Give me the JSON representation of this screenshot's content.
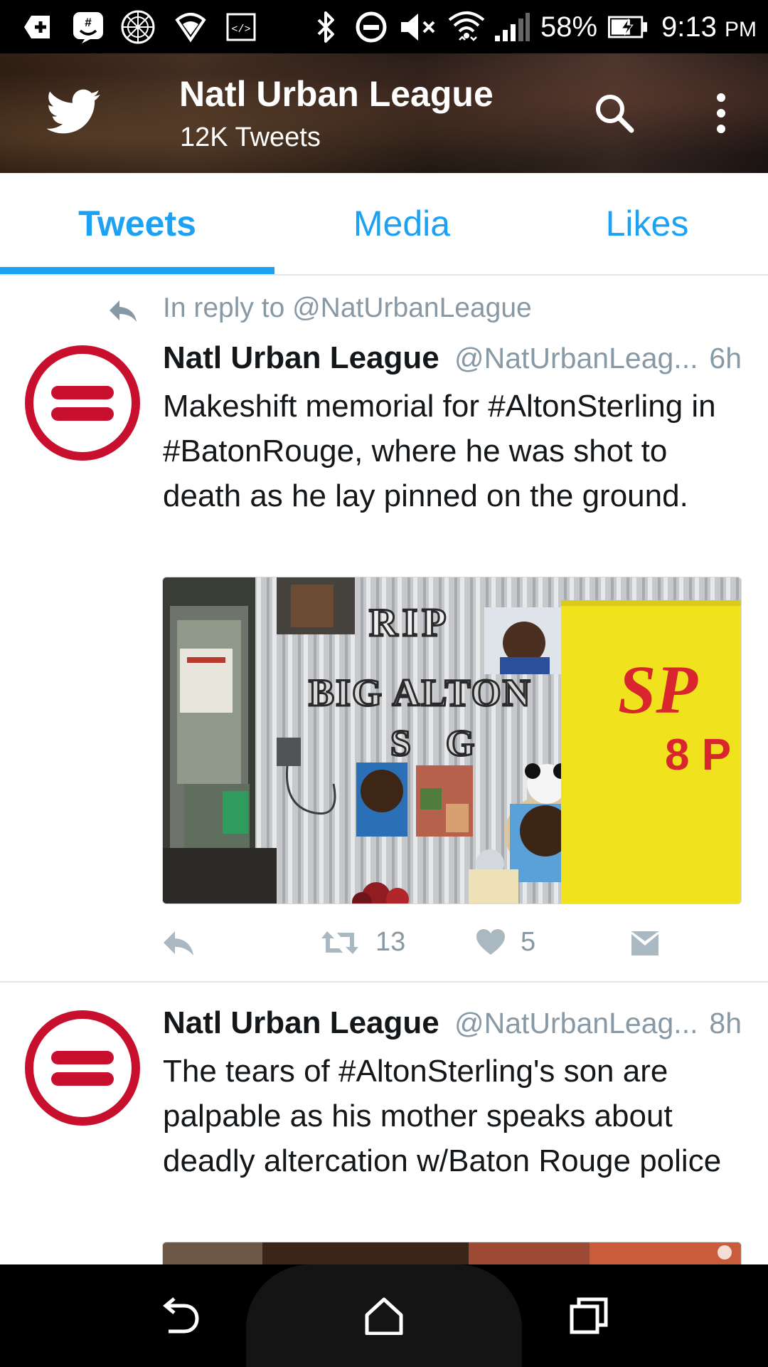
{
  "status_bar": {
    "battery_percent": "58%",
    "time": "9:13",
    "ampm": "PM",
    "icons": [
      "add-box-icon",
      "groupme-icon",
      "sphere-icon",
      "wifi-shield-icon",
      "code-icon",
      "bluetooth-icon",
      "do-not-disturb-icon",
      "mute-icon",
      "wifi-icon",
      "signal-icon",
      "battery-charging-icon"
    ]
  },
  "header": {
    "title": "Natl Urban League",
    "subtitle": "12K Tweets"
  },
  "tabs": [
    {
      "label": "Tweets",
      "active": true
    },
    {
      "label": "Media",
      "active": false
    },
    {
      "label": "Likes",
      "active": false
    }
  ],
  "tweets": [
    {
      "reply_context": "In reply to @NatUrbanLeague",
      "name": "Natl Urban League",
      "handle": "@NatUrbanLeag...",
      "time": "6h",
      "text": "Makeshift memorial for #AltonSterling in #BatonRouge, where he was shot to death as he lay pinned on the ground.",
      "media": {
        "banner_line1": "SP",
        "banner_line2": "8 P",
        "rip": "RIP",
        "big_alton": "BIG ALTON",
        "sg": "S G"
      },
      "retweets": "13",
      "likes": "5"
    },
    {
      "name": "Natl Urban League",
      "handle": "@NatUrbanLeag...",
      "time": "8h",
      "text": "The tears of #AltonSterling's son are palpable as his mother speaks about deadly altercation w/Baton Rouge police"
    }
  ],
  "colors": {
    "accent": "#1da1f2",
    "muted": "#8899a6",
    "avatar_red": "#c8102e"
  }
}
